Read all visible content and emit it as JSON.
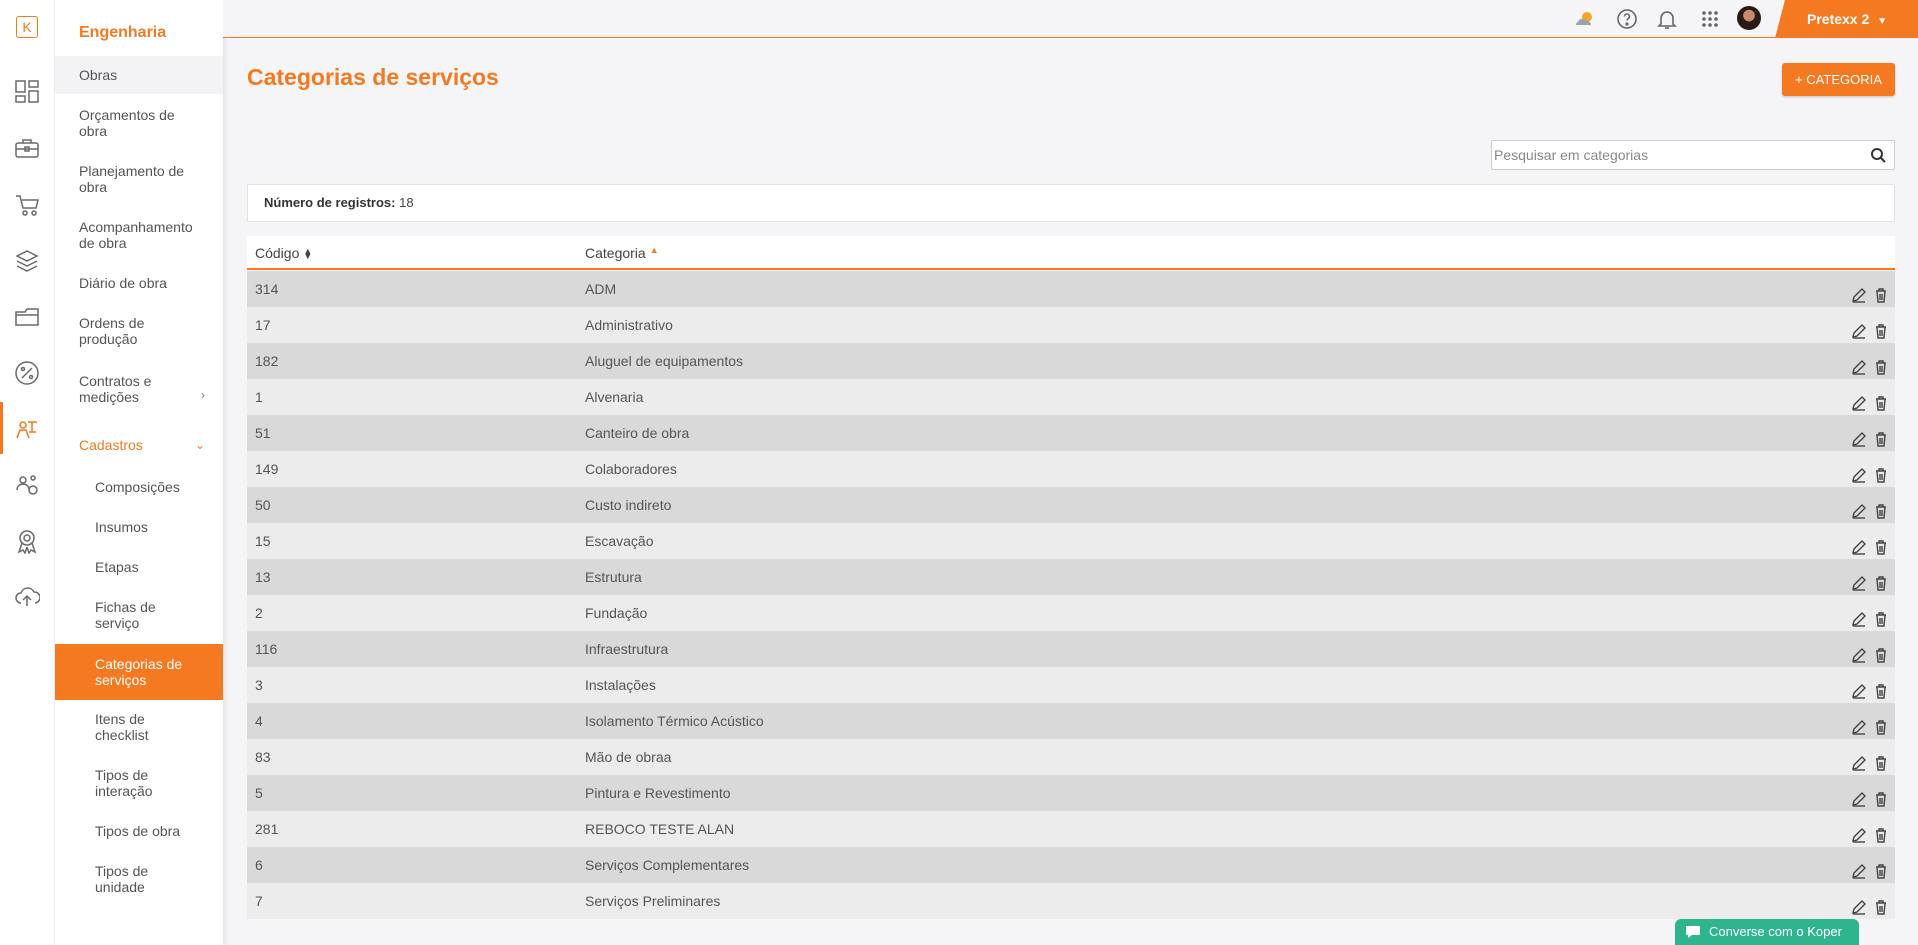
{
  "rail": {
    "logo": "K",
    "icons": [
      "dashboard-icon",
      "briefcase-icon",
      "cart-icon",
      "boxes-icon",
      "folder-icon",
      "percent-icon",
      "engineering-icon",
      "people-settings-icon",
      "award-icon",
      "cloud-upload-icon"
    ]
  },
  "menu": {
    "title": "Engenharia",
    "items": [
      "Obras",
      "Orçamentos de obra",
      "Planejamento de obra",
      "Acompanhamento de obra",
      "Diário de obra",
      "Ordens de produção",
      "Contratos e medições",
      "Cadastros"
    ],
    "sub_items": [
      "Composições",
      "Insumos",
      "Etapas",
      "Fichas de serviço",
      "Categorias de serviços",
      "Itens de checklist",
      "Tipos de interação",
      "Tipos de obra",
      "Tipos de unidade"
    ]
  },
  "topbar": {
    "user": "Pretexx 2",
    "icons": [
      "weather-icon",
      "help-icon",
      "bell-icon",
      "apps-grid-icon"
    ]
  },
  "page": {
    "title": "Categorias de serviços",
    "add_button": "CATEGORIA",
    "search_placeholder": "Pesquisar em categorias",
    "count_label": "Número de registros:",
    "count_value": "18"
  },
  "table": {
    "headers": {
      "code": "Código",
      "category": "Categoria"
    },
    "rows": [
      {
        "code": "314",
        "category": "ADM"
      },
      {
        "code": "17",
        "category": "Administrativo"
      },
      {
        "code": "182",
        "category": "Aluguel de equipamentos"
      },
      {
        "code": "1",
        "category": "Alvenaria"
      },
      {
        "code": "51",
        "category": "Canteiro de obra"
      },
      {
        "code": "149",
        "category": "Colaboradores"
      },
      {
        "code": "50",
        "category": "Custo indireto"
      },
      {
        "code": "15",
        "category": "Escavação"
      },
      {
        "code": "13",
        "category": "Estrutura"
      },
      {
        "code": "2",
        "category": "Fundação"
      },
      {
        "code": "116",
        "category": "Infraestrutura"
      },
      {
        "code": "3",
        "category": "Instalações"
      },
      {
        "code": "4",
        "category": "Isolamento Térmico Acústico"
      },
      {
        "code": "83",
        "category": "Mão de obraa"
      },
      {
        "code": "5",
        "category": "Pintura e Revestimento"
      },
      {
        "code": "281",
        "category": "REBOCO TESTE ALAN"
      },
      {
        "code": "6",
        "category": "Serviços Complementares"
      },
      {
        "code": "7",
        "category": "Serviços Preliminares"
      }
    ]
  },
  "chat": {
    "label": "Converse com o Koper"
  },
  "colors": {
    "accent": "#f47920",
    "chat": "#2fb58e"
  }
}
